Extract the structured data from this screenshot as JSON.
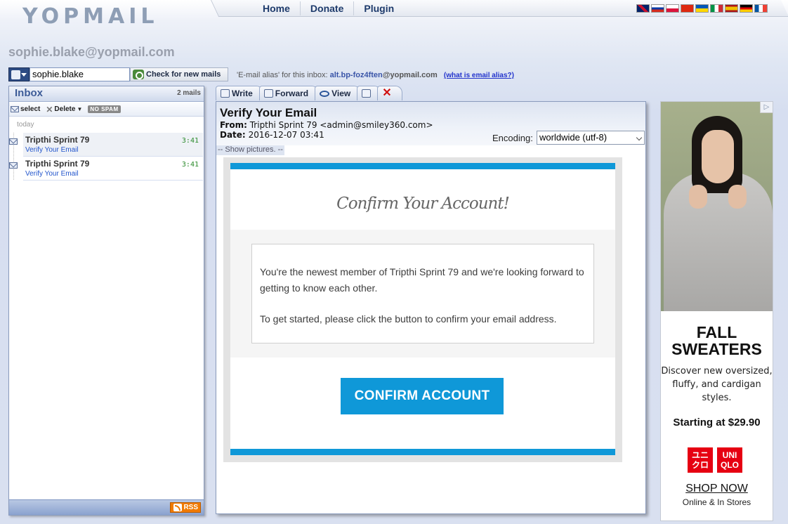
{
  "header": {
    "logo_text": "YOPMAIL",
    "nav": [
      "Home",
      "Donate",
      "Plugin"
    ],
    "flags": [
      "en",
      "ru",
      "pl",
      "cn",
      "ua",
      "it",
      "es",
      "de",
      "fr"
    ]
  },
  "account": {
    "email": "sophie.blake@yopmail.com",
    "login_value": "sophie.blake",
    "check_button": "Check for new mails",
    "alias_prefix": "'E-mail alias' for this inbox:",
    "alias_name": "alt.bp-foz4ften",
    "alias_domain": "@yopmail.com",
    "alias_help": "(what is email alias?)"
  },
  "inbox": {
    "title": "Inbox",
    "count": "2 mails",
    "tools": {
      "select": "select",
      "delete": "Delete",
      "nospam": "NO SPAM"
    },
    "group_label": "today",
    "messages": [
      {
        "from": "Tripthi Sprint 79",
        "subject": "Verify Your Email",
        "time": "3:41"
      },
      {
        "from": "Tripthi Sprint 79",
        "subject": "Verify Your Email",
        "time": "3:41"
      }
    ],
    "rss": "RSS"
  },
  "mail_tabs": {
    "write": "Write",
    "forward": "Forward",
    "view": "View"
  },
  "mail": {
    "subject": "Verify Your Email",
    "from_label": "From:",
    "from_value": "Tripthi Sprint 79 <admin@smiley360.com>",
    "date_label": "Date:",
    "date_value": "2016-12-07 03:41",
    "encoding_label": "Encoding:",
    "encoding_value": "worldwide (utf-8)",
    "show_pictures": "-- Show pictures. --"
  },
  "email_body": {
    "heading": "Confirm Your Account!",
    "para1": "You're the newest member of Tripthi Sprint 79 and we're looking forward to getting to know each other.",
    "para2": "To get started, please click the button to confirm your email address.",
    "button": "CONFIRM ACCOUNT",
    "accent_color": "#0f98d8"
  },
  "ad": {
    "headline": "FALL SWEATERS",
    "subtext": "Discover new oversized, fluffy, and cardigan styles.",
    "price": "Starting at $29.90",
    "logo_left": "ユニ クロ",
    "logo_right": "UNI QLO",
    "cta": "SHOP NOW",
    "stores": "Online & In Stores"
  }
}
